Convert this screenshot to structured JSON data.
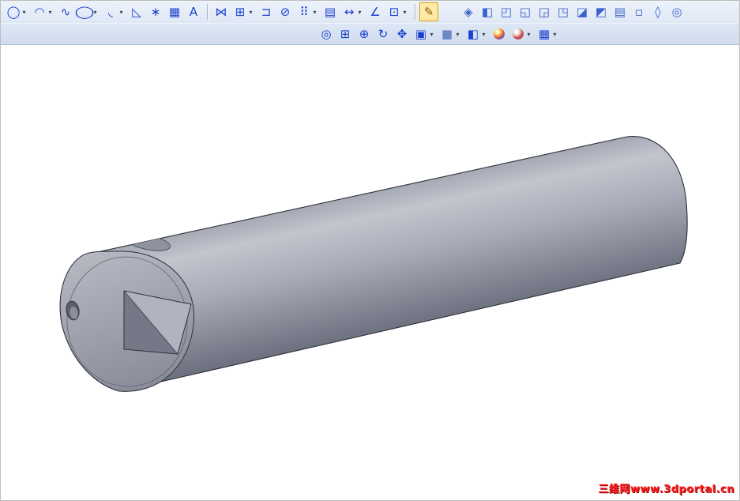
{
  "window": {
    "bg": "#ffffff",
    "border_color": "#bdbdbd"
  },
  "toolbar_style": {
    "bg_top": "#eef3fb",
    "bg_bottom": "#cfdcee",
    "border": "#aebed2",
    "icon_color": "#1b3fd0",
    "feature_icon_color": "#3b62c8",
    "dropdown_glyph": "▾"
  },
  "toolbars": {
    "sketch": {
      "groups": [
        {
          "items": [
            {
              "name": "circle-tool",
              "glyph": "◯",
              "dropdown": true
            },
            {
              "name": "centerpoint-arc-tool",
              "glyph": "◠",
              "dropdown": true
            },
            {
              "name": "spline-tool",
              "glyph": "∿"
            },
            {
              "name": "ellipse-tool",
              "glyph": "◯",
              "squish": true,
              "dropdown": true
            },
            {
              "name": "sketch-fillet-tool",
              "glyph": "◟",
              "dropdown": true
            },
            {
              "name": "sketch-chamfer-tool",
              "glyph": "◺"
            },
            {
              "name": "point-tool",
              "glyph": "∗"
            },
            {
              "name": "plane-grid-tool",
              "glyph": "▦"
            },
            {
              "name": "sketch-text-tool",
              "glyph": "A"
            }
          ]
        },
        {
          "items": [
            {
              "name": "mirror-entities-tool",
              "glyph": "⋈"
            },
            {
              "name": "convert-entities-tool",
              "glyph": "⊞",
              "dropdown": true
            },
            {
              "name": "offset-entities-tool",
              "glyph": "⊐"
            },
            {
              "name": "trim-entities-tool",
              "glyph": "⊘"
            },
            {
              "name": "linear-pattern-tool",
              "glyph": "⠿",
              "dropdown": true
            },
            {
              "name": "construction-geometry-tool",
              "glyph": "▤"
            },
            {
              "name": "move-entities-tool",
              "glyph": "↔",
              "dropdown": true
            },
            {
              "name": "measure-tool",
              "glyph": "∠"
            },
            {
              "name": "sketch-settings-tool",
              "glyph": "⊡",
              "dropdown": true
            }
          ]
        },
        {
          "items": [
            {
              "name": "sketch-mode",
              "glyph": "✎",
              "highlight": true,
              "color": "#8a5800"
            }
          ]
        },
        {
          "gap": 26,
          "items": [
            {
              "name": "extruded-boss-feature",
              "glyph": "◈",
              "color": "#3b62c8"
            },
            {
              "name": "extruded-cut-feature",
              "glyph": "◧",
              "color": "#3b62c8"
            },
            {
              "name": "revolved-boss-feature",
              "glyph": "◰",
              "color": "#3b62c8"
            },
            {
              "name": "revolved-cut-feature",
              "glyph": "◱",
              "color": "#3b62c8"
            },
            {
              "name": "swept-boss-feature",
              "glyph": "◲",
              "color": "#3b62c8"
            },
            {
              "name": "lofted-boss-feature",
              "glyph": "◳",
              "color": "#3b62c8"
            },
            {
              "name": "fillet-feature",
              "glyph": "◪",
              "color": "#3b62c8"
            },
            {
              "name": "chamfer-feature",
              "glyph": "◩",
              "color": "#3b62c8"
            },
            {
              "name": "rib-feature",
              "glyph": "▤",
              "color": "#3b62c8"
            },
            {
              "name": "shell-feature",
              "glyph": "▫",
              "color": "#3b62c8"
            },
            {
              "name": "draft-feature",
              "glyph": "◊",
              "color": "#3b62c8"
            },
            {
              "name": "hole-wizard-feature",
              "glyph": "◎",
              "color": "#3b62c8"
            }
          ]
        }
      ]
    },
    "view": {
      "groups": [
        {
          "items": [
            {
              "name": "zoom-to-fit",
              "glyph": "◎"
            },
            {
              "name": "zoom-to-area",
              "glyph": "⊞"
            },
            {
              "name": "zoom-in-out",
              "glyph": "⊕"
            },
            {
              "name": "rotate-view",
              "glyph": "↻"
            },
            {
              "name": "pan-view",
              "glyph": "✥"
            },
            {
              "name": "standard-views",
              "glyph": "▣",
              "dropdown": true
            },
            {
              "name": "shaded-display",
              "glyph": "■",
              "color": "#6f87c7",
              "dropdown": true
            },
            {
              "name": "section-view",
              "glyph": "◧",
              "dropdown": true
            },
            {
              "name": "realview-graphics",
              "shape": "sphere"
            },
            {
              "name": "appearances",
              "shape": "sphere2",
              "dropdown": true
            },
            {
              "name": "scene-settings",
              "glyph": "▦",
              "dropdown": true
            }
          ]
        }
      ]
    }
  },
  "viewport": {
    "bg": "#ffffff",
    "model_color": "#a4a8b4",
    "model_highlight": "#c2c5cd",
    "model_shadow": "#6e7280",
    "edge_color": "#2e3138"
  },
  "watermark": {
    "text": "三维网www.3dportal.cn",
    "color": "#ff1c1c"
  }
}
